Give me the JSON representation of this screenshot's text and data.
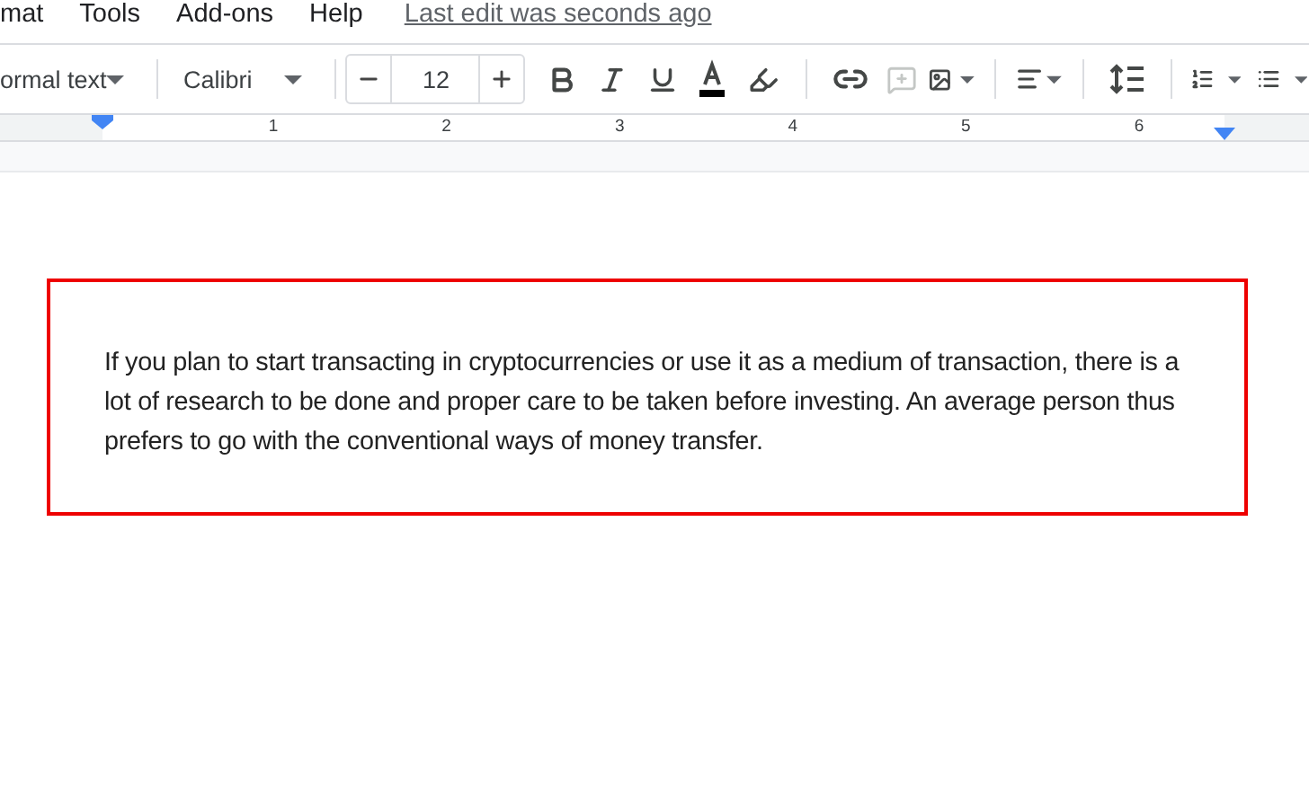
{
  "menu": [
    {
      "label": "mat"
    },
    {
      "label": "Tools"
    },
    {
      "label": "Add-ons"
    },
    {
      "label": "Help"
    }
  ],
  "last_edit": "Last edit was seconds ago",
  "toolbar": {
    "style": "ormal text",
    "font": "Calibri",
    "font_size": "12",
    "insert_comment": {
      "disabled": true
    }
  },
  "ruler": {
    "numbers": [
      "1",
      "2",
      "3",
      "4",
      "5",
      "6"
    ]
  },
  "document": {
    "paragraph": "If you plan to start transacting in cryptocurrencies or use it as a medium of transaction, there is a lot of research to be done and proper care to be taken before investing. An average person thus prefers to go with the conventional ways of money transfer."
  }
}
